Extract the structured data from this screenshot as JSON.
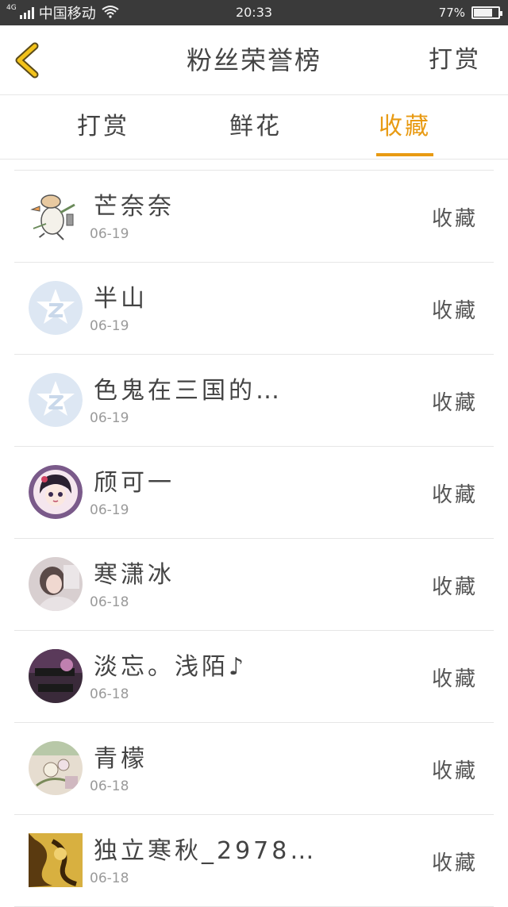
{
  "status_bar": {
    "network": "4G",
    "carrier": "中国移动",
    "time": "20:33",
    "battery_text": "77%",
    "battery_level": 0.77
  },
  "header": {
    "title": "粉丝荣誉榜",
    "right_action": "打赏",
    "accent_color": "#e89a12"
  },
  "tabs": [
    {
      "label": "打赏",
      "active": false
    },
    {
      "label": "鲜花",
      "active": false
    },
    {
      "label": "收藏",
      "active": true
    }
  ],
  "fans": [
    {
      "name": "芒奈奈",
      "date": "06-19",
      "action": "收藏",
      "avatar": "cartoon-duck-avatar"
    },
    {
      "name": "半山",
      "date": "06-19",
      "action": "收藏",
      "avatar": "default-qq-avatar"
    },
    {
      "name": "色鬼在三国的…",
      "date": "06-19",
      "action": "收藏",
      "avatar": "default-qq-avatar"
    },
    {
      "name": "颀可一",
      "date": "06-19",
      "action": "收藏",
      "avatar": "anime-girl-avatar"
    },
    {
      "name": "寒潇冰",
      "date": "06-18",
      "action": "收藏",
      "avatar": "photo-girl-avatar"
    },
    {
      "name": "淡忘。浅陌♪",
      "date": "06-18",
      "action": "收藏",
      "avatar": "dark-text-avatar"
    },
    {
      "name": "青檬",
      "date": "06-18",
      "action": "收藏",
      "avatar": "flower-avatar"
    },
    {
      "name": "独立寒秋_2978…",
      "date": "06-18",
      "action": "收藏",
      "avatar": "gold-sculpture-avatar"
    }
  ]
}
